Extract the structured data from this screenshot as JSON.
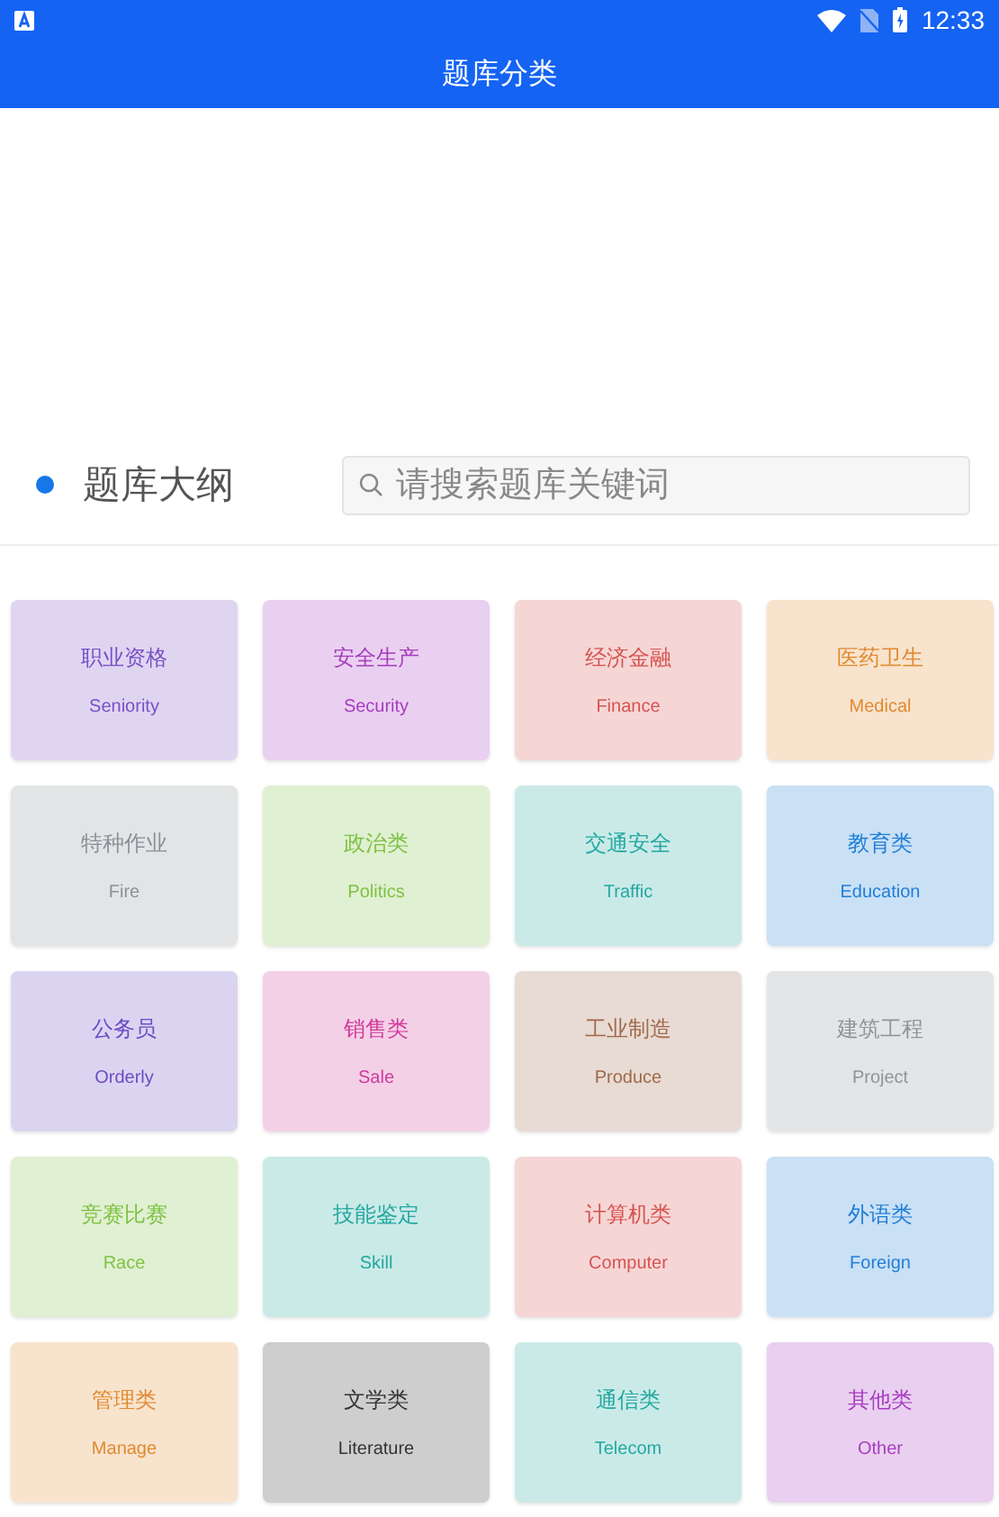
{
  "status_bar": {
    "time": "12:33"
  },
  "app_bar": {
    "title": "题库分类"
  },
  "section": {
    "title": "题库大纲",
    "search": {
      "placeholder": "请搜索题库关键词"
    }
  },
  "categories": [
    {
      "name": "职业资格",
      "english": "Seniority",
      "color": "#7a4fc6"
    },
    {
      "name": "安全生产",
      "english": "Security",
      "color": "#a63cc0"
    },
    {
      "name": "经济金融",
      "english": "Finance",
      "color": "#d65350"
    },
    {
      "name": "医药卫生",
      "english": "Medical",
      "color": "#e08a30"
    },
    {
      "name": "特种作业",
      "english": "Fire",
      "color": "#8a9098"
    },
    {
      "name": "政治类",
      "english": "Politics",
      "color": "#7fc143"
    },
    {
      "name": "交通安全",
      "english": "Traffic",
      "color": "#23a8a0"
    },
    {
      "name": "教育类",
      "english": "Education",
      "color": "#1f7ed6"
    },
    {
      "name": "公务员",
      "english": "Orderly",
      "color": "#6a4bc4"
    },
    {
      "name": "销售类",
      "english": "Sale",
      "color": "#d03a9a"
    },
    {
      "name": "工业制造",
      "english": "Produce",
      "color": "#a0694a"
    },
    {
      "name": "建筑工程",
      "english": "Project",
      "color": "#8e949b"
    },
    {
      "name": "竞赛比赛",
      "english": "Race",
      "color": "#7fc143"
    },
    {
      "name": "技能鉴定",
      "english": "Skill",
      "color": "#23a8a0"
    },
    {
      "name": "计算机类",
      "english": "Computer",
      "color": "#d65350"
    },
    {
      "name": "外语类",
      "english": "Foreign",
      "color": "#1f7ed6"
    },
    {
      "name": "管理类",
      "english": "Manage",
      "color": "#e08a30"
    },
    {
      "name": "文学类",
      "english": "Literature",
      "color": "#333333"
    },
    {
      "name": "通信类",
      "english": "Telecom",
      "color": "#23a8a0"
    },
    {
      "name": "其他类",
      "english": "Other",
      "color": "#a63cc0"
    }
  ]
}
